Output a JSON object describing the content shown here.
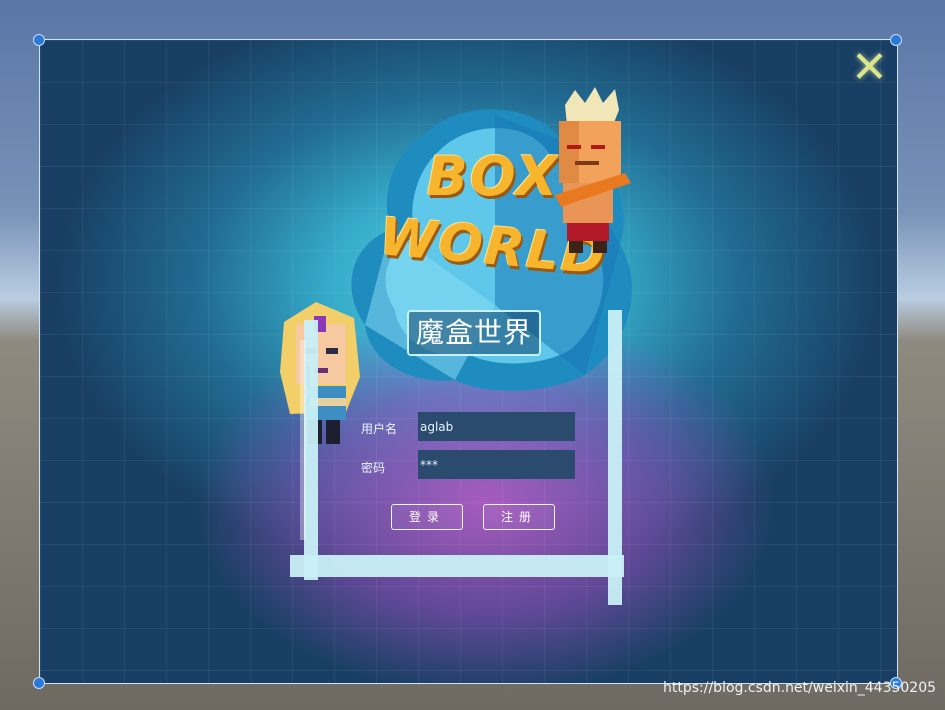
{
  "game": {
    "logo_line1": "BOX",
    "logo_line2": "WORLD",
    "logo_subtitle": "魔盒世界",
    "close_icon": "x-icon"
  },
  "login_form": {
    "username_label": "用户名",
    "username_value": "aglab",
    "password_label": "密码",
    "password_value": "***",
    "login_button": "登录",
    "register_button": "注册"
  },
  "watermark": "https://blog.csdn.net/weixin_44350205",
  "colors": {
    "accent_gold": "#f6b52c",
    "field_bg": "#2a4a6e",
    "frame_stroke": "#c9f0f7"
  }
}
